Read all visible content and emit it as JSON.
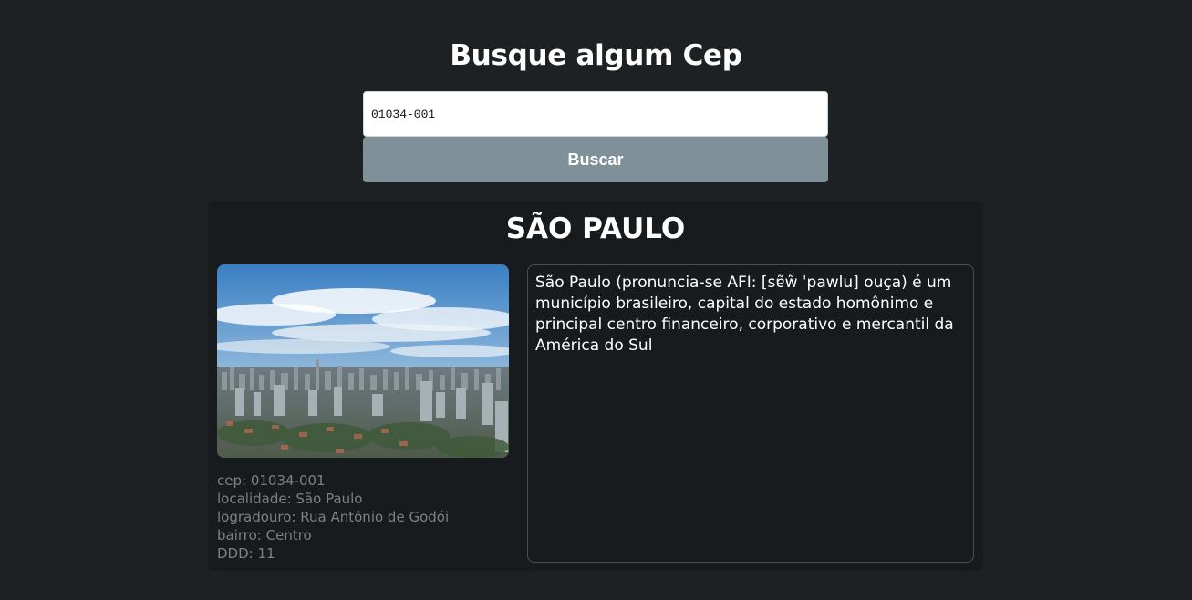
{
  "header": {
    "title": "Busque algum Cep"
  },
  "search": {
    "value": "01034-001",
    "button_label": "Buscar"
  },
  "result": {
    "city_name": "SÃO PAULO",
    "image_icon": "city-skyline-photo",
    "info": {
      "cep": "cep: 01034-001",
      "localidade": "localidade: São Paulo",
      "logradouro": "logradouro: Rua Antônio de Godói",
      "bairro": "bairro: Centro",
      "ddd": "DDD: 11"
    },
    "description": "São Paulo (pronuncia-se AFI: [sɐ̃w̃ ˈpawlu] ouça) é um município brasileiro, capital do estado homônimo e principal centro financeiro, corporativo e mercantil da América do Sul"
  },
  "colors": {
    "background": "#1d2123",
    "card": "#181b1d",
    "button": "#7f9098",
    "muted_text": "#7c8184"
  }
}
